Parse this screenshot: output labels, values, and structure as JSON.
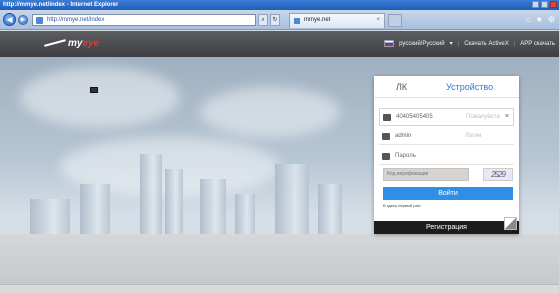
{
  "window": {
    "title": "http://mmye.net/index - Internet Explorer"
  },
  "toolbar": {
    "back_glyph": "◀",
    "forward_glyph": "▶",
    "address": "http://mmye.net/index",
    "search_glyph": "⌕",
    "refresh_glyph": "↻",
    "tab_label": "mmye.net",
    "tab_close": "×",
    "home_glyph": "⌂",
    "favorites_glyph": "★",
    "tools_glyph": "⚙"
  },
  "header": {
    "logo_prefix": "my",
    "logo_accent": "eye",
    "language": "русский/Русский",
    "language_caret": "▾",
    "download": "Скачать ActiveX",
    "app": "APP скачать"
  },
  "login": {
    "tab_lk": "ЛК",
    "tab_device": "Устройство",
    "device_id": "40405405405",
    "device_id_ghost": "Пожалуйста",
    "clear_glyph": "×",
    "username": "admin",
    "username_ghost": "Логин",
    "password_placeholder": "Пароль",
    "captcha_placeholder": "Код верификации",
    "captcha_code": "2529",
    "submit": "Войти",
    "first_time": "В здесь первый раз!",
    "register": "Регистрация"
  },
  "colors": {
    "accent": "#2f8fe6",
    "header_bg": "#4a4c50",
    "register_bg": "#1d1d1d"
  }
}
